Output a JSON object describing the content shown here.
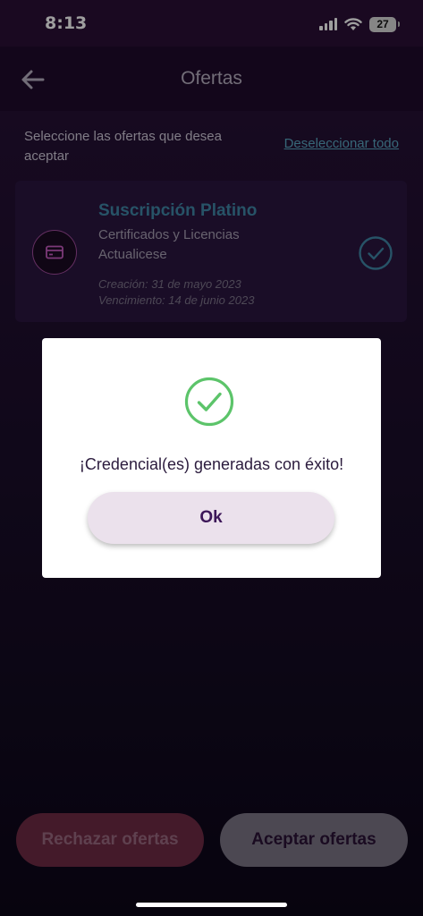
{
  "status_bar": {
    "time": "8:13",
    "battery": "27"
  },
  "header": {
    "title": "Ofertas",
    "back_icon": "back-arrow-icon"
  },
  "selection": {
    "instructions": "Seleccione las ofertas que desea aceptar",
    "deselect_all": "Deseleccionar todo"
  },
  "offers": [
    {
      "icon": "credit-card-icon",
      "title": "Suscripción Platino",
      "description": "Certificados y Licencias Actualicese",
      "created": "Creación: 31 de mayo 2023",
      "expires": "Vencimiento: 14 de junio 2023",
      "selected": true
    }
  ],
  "actions": {
    "reject_label": "Rechazar ofertas",
    "accept_label": "Aceptar ofertas"
  },
  "dialog": {
    "icon": "success-check-icon",
    "message": "¡Credencial(es) generadas con éxito!",
    "ok_label": "Ok"
  },
  "colors": {
    "accent_teal": "#3f86a6",
    "success_green": "#5cc46a",
    "primary_purple": "#3c1658"
  }
}
